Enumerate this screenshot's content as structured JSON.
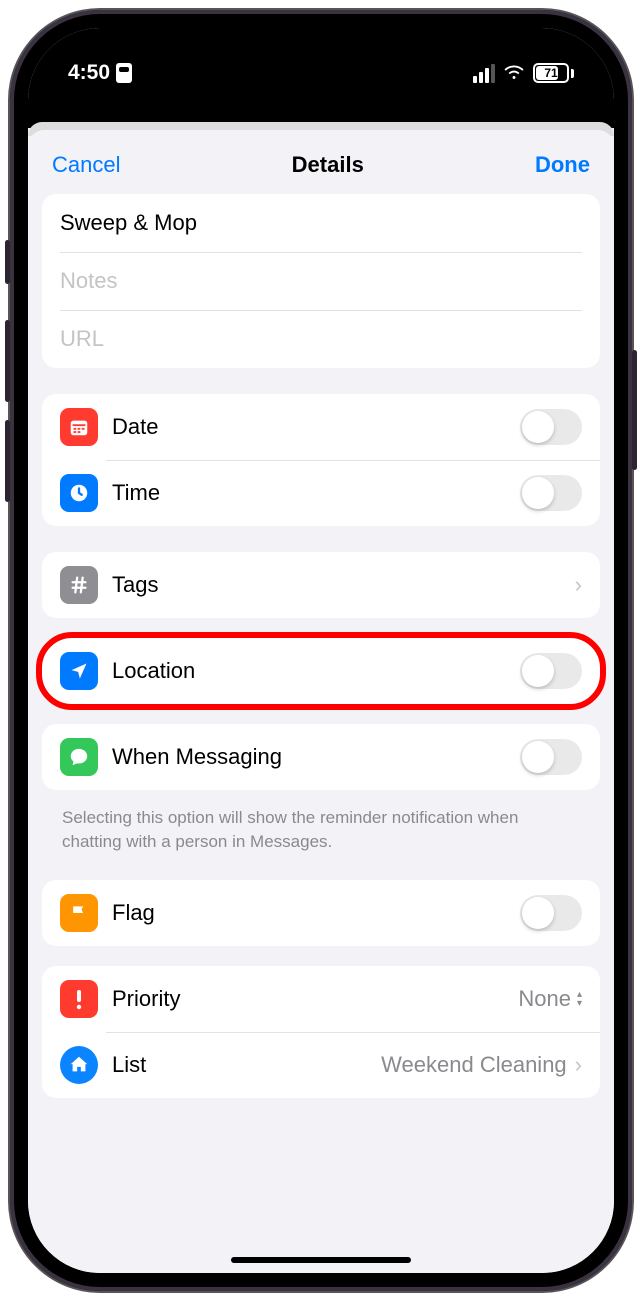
{
  "status": {
    "time": "4:50",
    "battery": "71"
  },
  "nav": {
    "cancel": "Cancel",
    "title": "Details",
    "done": "Done"
  },
  "reminder": {
    "title": "Sweep & Mop",
    "notes_placeholder": "Notes",
    "url_placeholder": "URL"
  },
  "rows": {
    "date": "Date",
    "time": "Time",
    "tags": "Tags",
    "location": "Location",
    "messaging": "When Messaging",
    "flag": "Flag",
    "priority": "Priority",
    "priority_value": "None",
    "list": "List",
    "list_value": "Weekend Cleaning"
  },
  "footer": {
    "messaging_note": "Selecting this option will show the reminder notification when chatting with a person in Messages."
  },
  "colors": {
    "red": "#ff3b30",
    "blue": "#007aff",
    "gray": "#8e8e93",
    "green": "#34c759",
    "orange": "#ff9500",
    "listblue": "#0a84ff"
  }
}
